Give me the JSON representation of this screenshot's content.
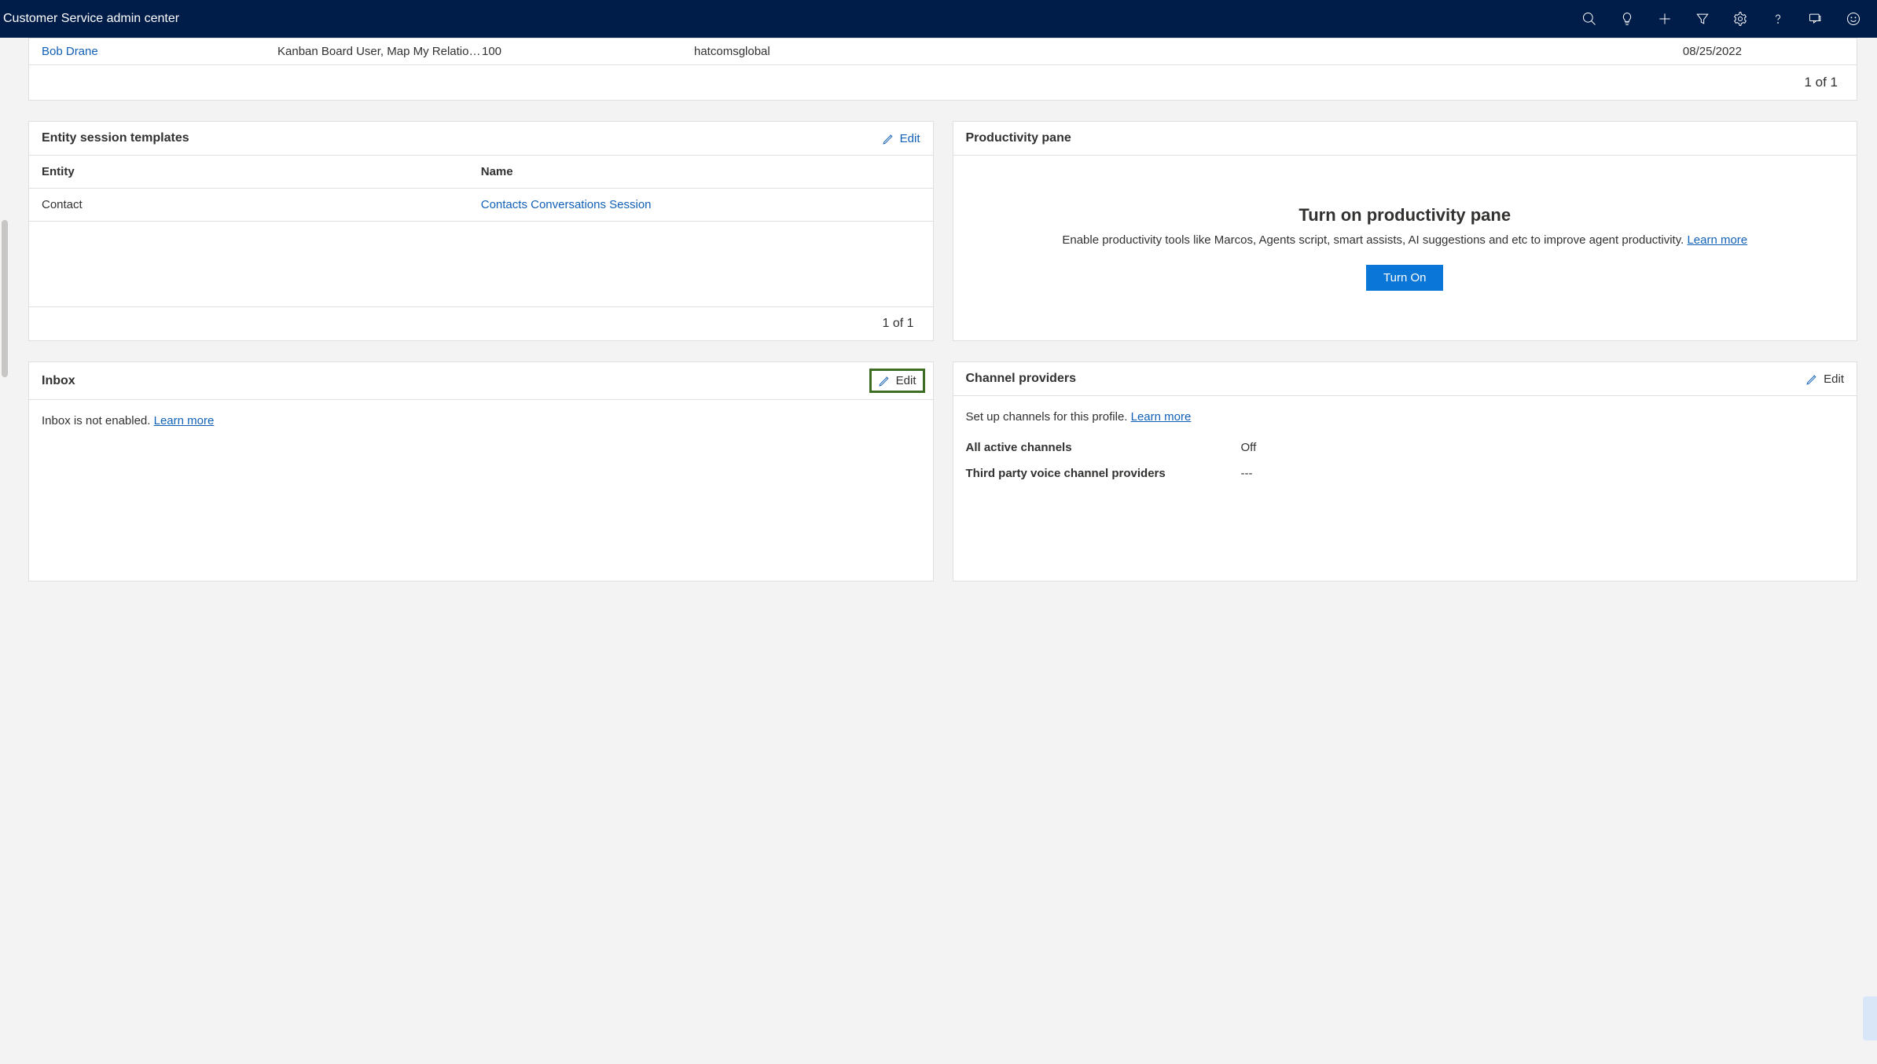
{
  "header": {
    "title": "Customer Service admin center"
  },
  "topRow": {
    "name": "Bob Drane",
    "roles": "Kanban Board User, Map My Relatio…",
    "capacity": "100",
    "org": "hatcomsglobal",
    "date": "08/25/2022",
    "pager": "1 of 1"
  },
  "entitySession": {
    "title": "Entity session templates",
    "editLabel": "Edit",
    "colEntity": "Entity",
    "colName": "Name",
    "rowEntity": "Contact",
    "rowName": "Contacts Conversations Session",
    "pager": "1 of 1"
  },
  "productivity": {
    "title": "Productivity pane",
    "heading": "Turn on productivity pane",
    "desc": "Enable productivity tools like Marcos, Agents script, smart assists, AI suggestions and etc to improve agent productivity. ",
    "learnMore": "Learn more",
    "button": "Turn On"
  },
  "inbox": {
    "title": "Inbox",
    "editLabel": "Edit",
    "text": "Inbox is not enabled. ",
    "learnMore": "Learn more"
  },
  "channels": {
    "title": "Channel providers",
    "editLabel": "Edit",
    "lead": "Set up channels for this profile. ",
    "learnMore": "Learn more",
    "row1Label": "All active channels",
    "row1Value": "Off",
    "row2Label": "Third party voice channel providers",
    "row2Value": "---"
  }
}
